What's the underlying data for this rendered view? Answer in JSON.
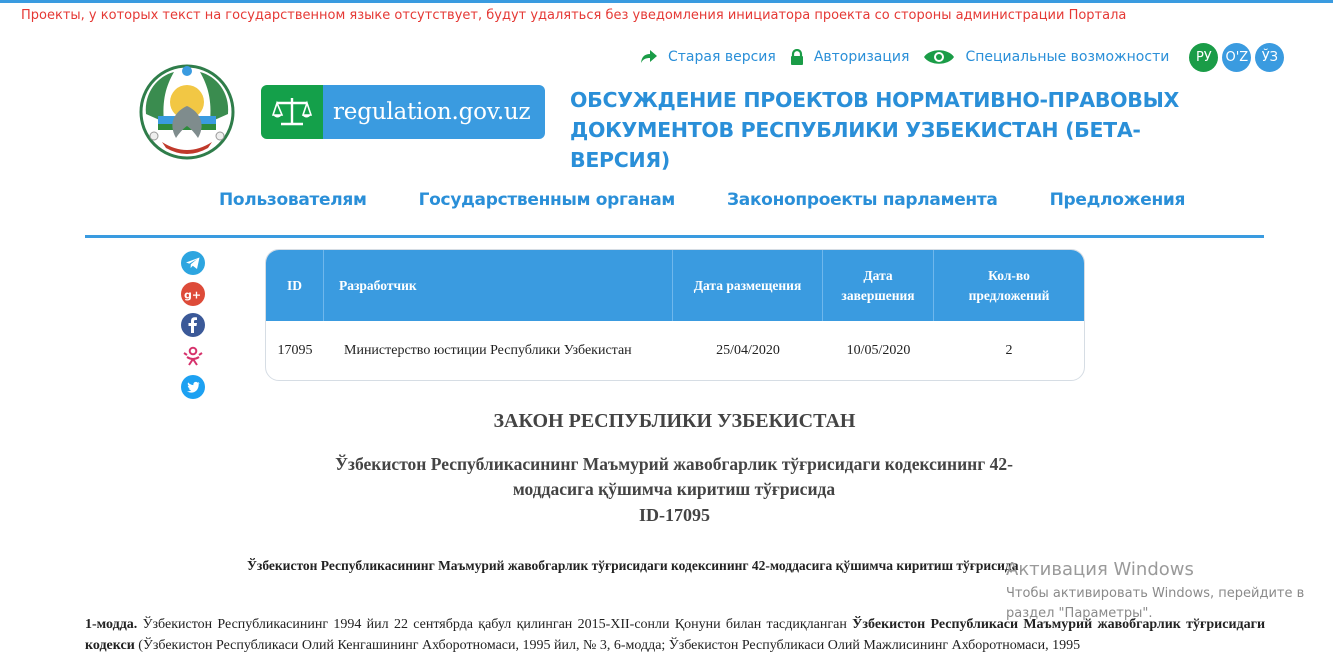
{
  "notice": "Проекты, у которых текст на государственном языке отсутствует, будут удаляться без уведомления инициатора проекта со стороны администрации Портала",
  "toplinks": {
    "old_version": "Старая версия",
    "login": "Авторизация",
    "accessibility": "Специальные возможности"
  },
  "languages": [
    "РУ",
    "O'Z",
    "ЎЗ"
  ],
  "logo": {
    "text": "regulation.gov.uz"
  },
  "site_title": {
    "line1": "ОБСУЖДЕНИЕ ПРОЕКТОВ НОРМАТИВНО-ПРАВОВЫХ",
    "line2": "ДОКУМЕНТОВ РЕСПУБЛИКИ УЗБЕКИСТАН (БЕТА-ВЕРСИЯ)"
  },
  "nav": [
    "Пользователям",
    "Государственным органам",
    "Законопроекты парламента",
    "Предложения"
  ],
  "social": [
    "telegram-icon",
    "google-plus-icon",
    "facebook-icon",
    "odnoklassniki-icon",
    "twitter-icon"
  ],
  "table": {
    "headers": {
      "id": "ID",
      "developer": "Разработчик",
      "posted": "Дата размещения",
      "end_1": "Дата",
      "end_2": "завершения",
      "count_1": "Кол-во",
      "count_2": "предложений"
    },
    "row": {
      "id": "17095",
      "developer": "Министерство юстиции Республики Узбекистан",
      "posted": "25/04/2020",
      "end": "10/05/2020",
      "count": "2"
    }
  },
  "document": {
    "title": "ЗАКОН РЕСПУБЛИКИ УЗБЕКИСТАН",
    "subtitle_1": "Ўзбекистон Республикасининг Маъмурий жавобгарлик тўғрисидаги кодексининг 42-",
    "subtitle_2": "моддасига қўшимча киритиш тўғрисида",
    "id": "ID-17095",
    "heading2": "Ўзбекистон Республикасининг Маъмурий жавобгарлик тўғрисидаги кодексининг 42-моддасига қўшимча киритиш тўғрисида",
    "article_label": "1-модда.",
    "article_text1": "Ўзбекистон Республикасининг 1994 йил 22 сентябрда қабул қилинган 2015-XII-сонли Қонуни билан тасдиқланган",
    "article_bold": "Ўзбекистон Республикаси Маъмурий жавобгарлик тўғрисидаги кодекси",
    "article_text2": "(Ўзбекистон Республикаси Олий Кенгашининг Ахборотномаси, 1995 йил, № 3, 6-модда; Ўзбекистон Республикаси Олий Мажлисининг Ахборотномаси, 1995"
  },
  "watermark": {
    "line1": "Активация Windows",
    "line2": "Чтобы активировать Windows, перейдите в",
    "line3": "раздел \"Параметры\"."
  },
  "colors": {
    "accent": "#3a9be0",
    "green": "#14a04a",
    "notice": "#e53935"
  }
}
